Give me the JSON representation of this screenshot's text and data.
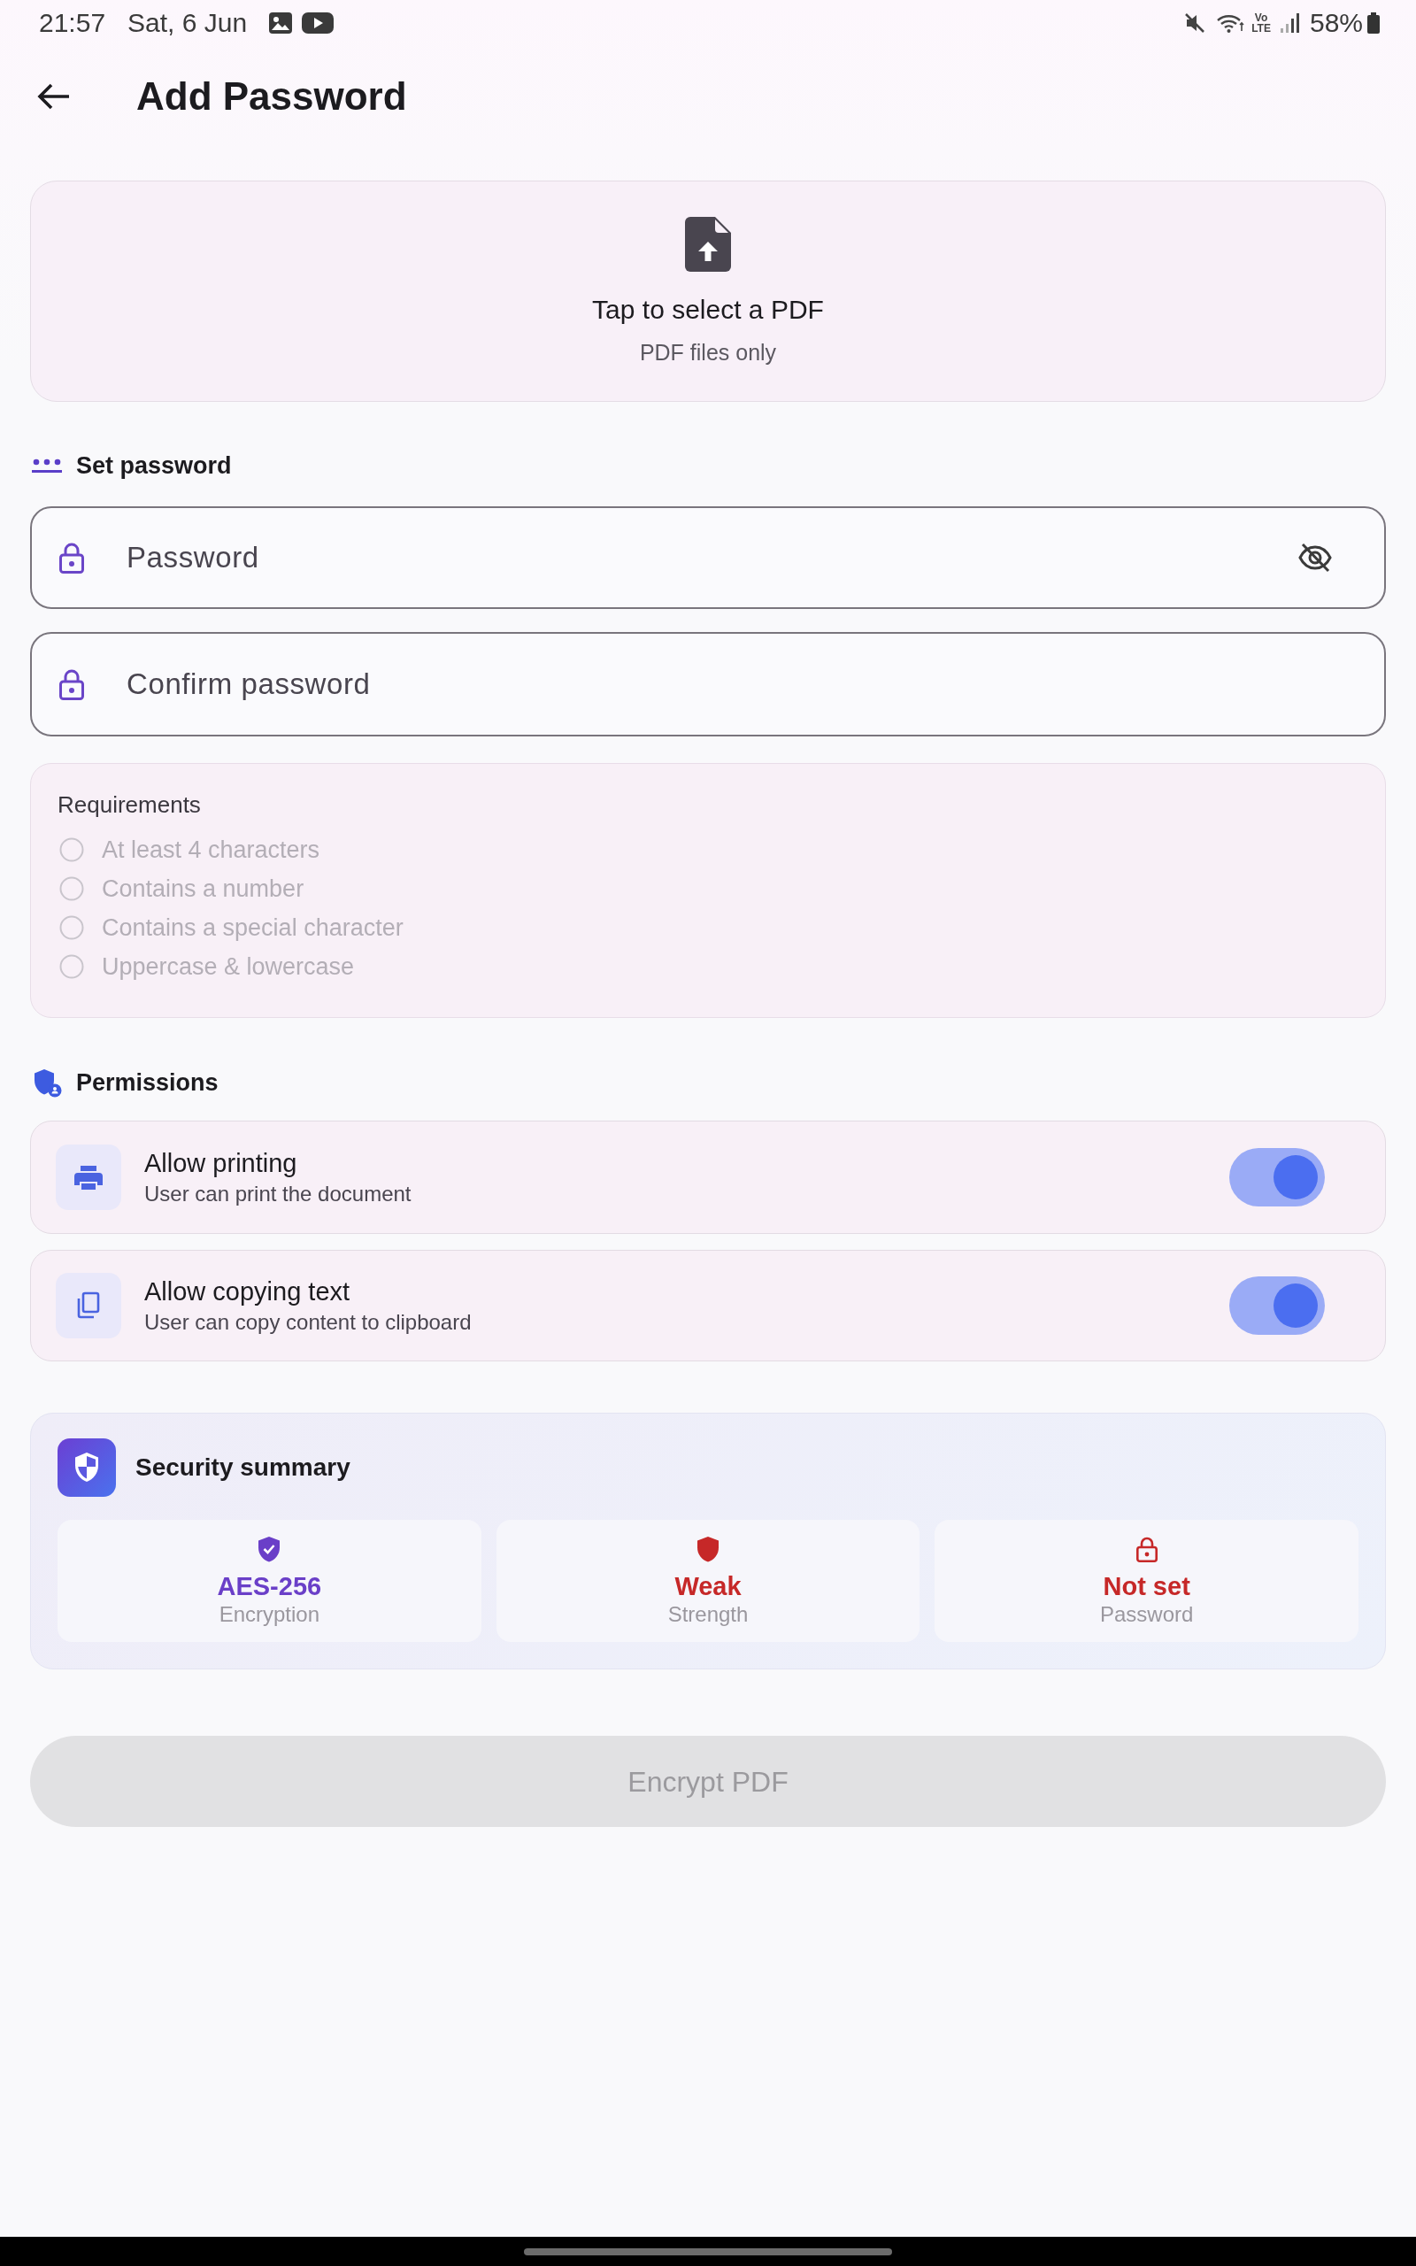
{
  "status_bar": {
    "time": "21:57",
    "date": "Sat, 6 Jun",
    "network_labels": [
      "Vo",
      "LTE"
    ],
    "battery": "58%"
  },
  "app_bar": {
    "title": "Add Password"
  },
  "file_picker": {
    "title": "Tap to select a PDF",
    "subtitle": "PDF files only"
  },
  "password_section": {
    "heading": "Set password",
    "fields": [
      {
        "kind": "password",
        "placeholder": "Password"
      },
      {
        "kind": "confirm",
        "placeholder": "Confirm password"
      }
    ]
  },
  "requirements": {
    "title": "Requirements",
    "items": [
      {
        "label": "At least 4 characters",
        "checked": false
      },
      {
        "label": "Contains a number",
        "checked": false
      },
      {
        "label": "Contains a special character",
        "checked": false
      },
      {
        "label": "Uppercase & lowercase",
        "checked": false
      }
    ]
  },
  "permissions": {
    "heading": "Permissions",
    "items": [
      {
        "kind": "print",
        "title": "Allow printing",
        "subtitle": "User can print the document",
        "on": true
      },
      {
        "kind": "copy",
        "title": "Allow copying text",
        "subtitle": "User can copy content to clipboard",
        "on": true
      }
    ]
  },
  "security_summary": {
    "title": "Security summary",
    "tiles": [
      {
        "kind": "encryption",
        "value": "AES-256",
        "label": "Encryption",
        "color": "#6a3fc8"
      },
      {
        "kind": "strength",
        "value": "Weak",
        "label": "Strength",
        "color": "#c62828"
      },
      {
        "kind": "password",
        "value": "Not set",
        "label": "Password",
        "color": "#c62828"
      }
    ]
  },
  "encrypt_button": {
    "label": "Encrypt PDF",
    "disabled": true
  }
}
